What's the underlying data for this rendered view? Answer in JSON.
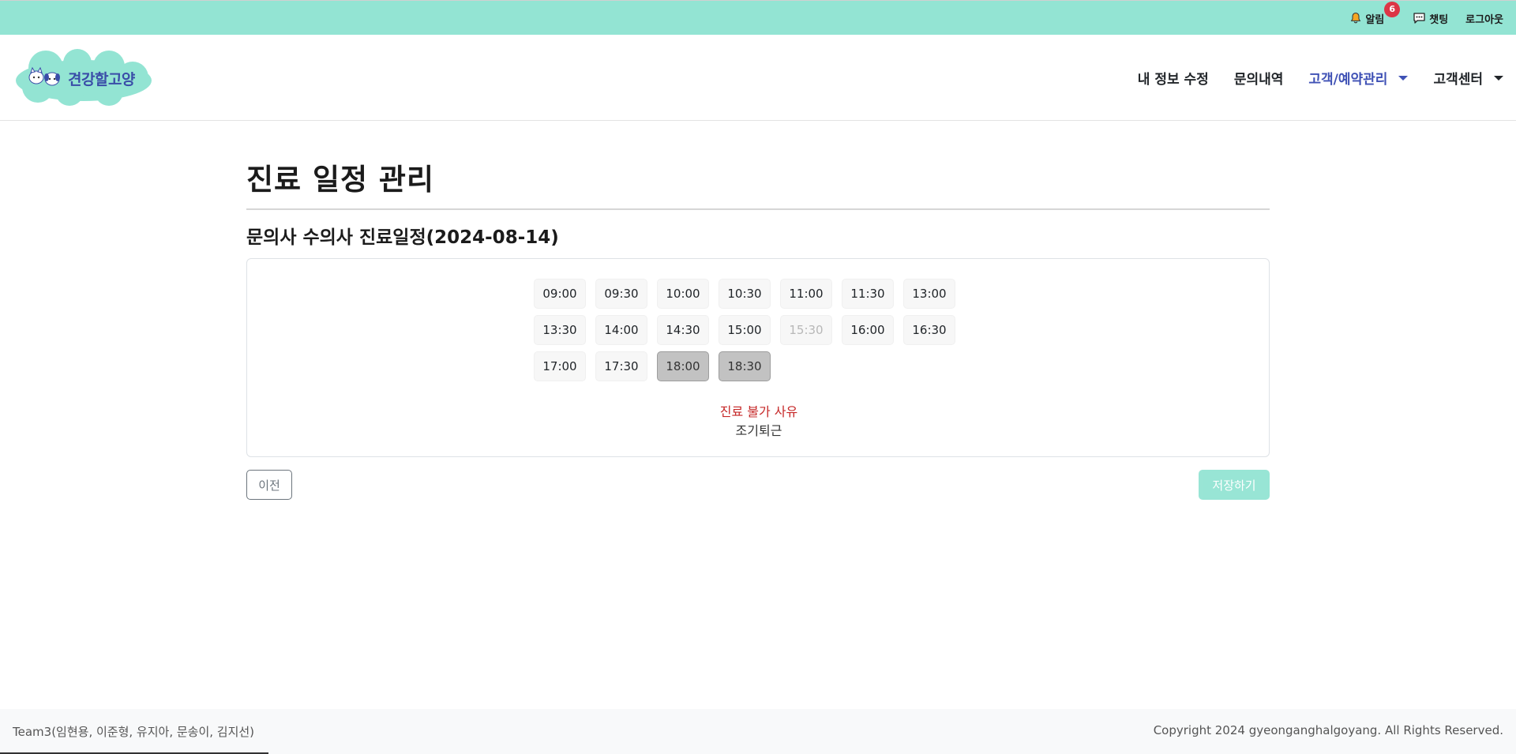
{
  "topbar": {
    "alarm_label": "알림",
    "alarm_count": "6",
    "chat_label": "챗팅",
    "logout_label": "로그아웃",
    "bg_color": "#93e4d3"
  },
  "header": {
    "logo_text": "견강할고양",
    "nav": {
      "edit_info": "내 정보 수정",
      "inquiry": "문의내역",
      "customer_reservation": "고객/예약관리",
      "customer_center": "고객센터"
    },
    "active_color": "#3f51b5"
  },
  "main": {
    "page_title": "진료 일정 관리",
    "sub_title": "문의사 수의사 진료일정(2024-08-14)",
    "slots": [
      {
        "time": "09:00",
        "state": "available"
      },
      {
        "time": "09:30",
        "state": "available"
      },
      {
        "time": "10:00",
        "state": "available"
      },
      {
        "time": "10:30",
        "state": "available"
      },
      {
        "time": "11:00",
        "state": "available"
      },
      {
        "time": "11:30",
        "state": "available"
      },
      {
        "time": "13:00",
        "state": "available"
      },
      {
        "time": "13:30",
        "state": "available"
      },
      {
        "time": "14:00",
        "state": "available"
      },
      {
        "time": "14:30",
        "state": "available"
      },
      {
        "time": "15:00",
        "state": "available"
      },
      {
        "time": "15:30",
        "state": "disabled"
      },
      {
        "time": "16:00",
        "state": "available"
      },
      {
        "time": "16:30",
        "state": "available"
      },
      {
        "time": "17:00",
        "state": "available"
      },
      {
        "time": "17:30",
        "state": "available"
      },
      {
        "time": "18:00",
        "state": "selected"
      },
      {
        "time": "18:30",
        "state": "selected"
      }
    ],
    "reason_title": "진료 불가 사유",
    "reason_text": "조기퇴근",
    "prev_button": "이전",
    "save_button": "저장하기"
  },
  "footer": {
    "team": "Team3(임현용, 이준형, 유지아, 문송이, 김지선)",
    "copyright": "Copyright 2024 gyeonganghalgoyang. All Rights Reserved."
  }
}
